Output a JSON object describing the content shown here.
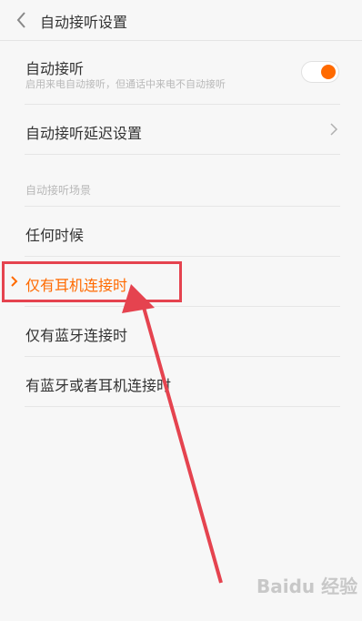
{
  "header": {
    "title": "自动接听设置",
    "back_icon": "chevron-left-icon"
  },
  "auto_answer": {
    "title": "自动接听",
    "subtitle": "启用来电自动接听，但通话中来电不自动接听",
    "toggle_on": true,
    "accent": "#ff6a00"
  },
  "delay": {
    "label": "自动接听延迟设置",
    "icon": "chevron-right-icon"
  },
  "scenarios": {
    "section_label": "自动接听场景",
    "options": [
      {
        "label": "任何时候",
        "selected": false
      },
      {
        "label": "仅有耳机连接时",
        "selected": true
      },
      {
        "label": "仅有蓝牙连接时",
        "selected": false
      },
      {
        "label": "有蓝牙或者耳机连接时",
        "selected": false
      }
    ]
  },
  "annotation": {
    "color": "#e5434f"
  },
  "watermark": {
    "text": "Baidu 经验"
  }
}
